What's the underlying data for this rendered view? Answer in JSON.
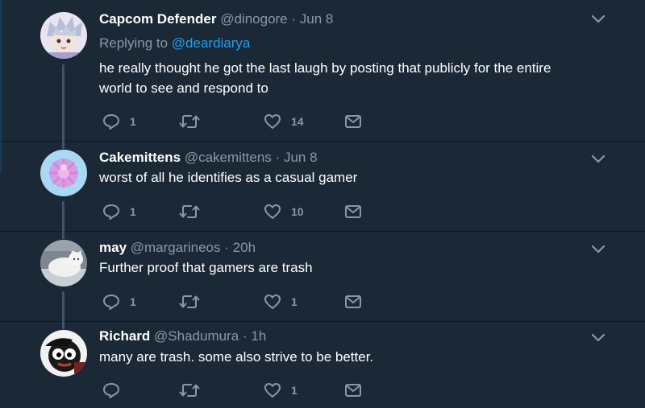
{
  "colors": {
    "background": "#1b2836",
    "muted": "#8899a6",
    "link": "#1da1f2",
    "thread_line": "#3d5466"
  },
  "tweets": [
    {
      "name": "Capcom Defender",
      "handle": "@dinogore",
      "dot": "·",
      "time": "Jun 8",
      "replying_label": "Replying to",
      "replying_mention": "@deardiarya",
      "text": "he really thought he got the last laugh by posting that publicly for the entire world to see and respond to",
      "replies": "1",
      "retweets": "",
      "likes": "14"
    },
    {
      "name": "Cakemittens",
      "handle": "@cakemittens",
      "dot": "·",
      "time": "Jun 8",
      "text": "worst of all he identifies as a casual gamer",
      "replies": "1",
      "retweets": "",
      "likes": "10"
    },
    {
      "name": "may",
      "handle": "@margarineos",
      "dot": "·",
      "time": "20h",
      "text": "Further proof that gamers are trash",
      "replies": "1",
      "retweets": "",
      "likes": "1"
    },
    {
      "name": "Richard",
      "handle": "@Shadumura",
      "dot": "·",
      "time": "1h",
      "text": "many are trash. some also strive to be better.",
      "replies": "",
      "retweets": "",
      "likes": "1"
    }
  ]
}
